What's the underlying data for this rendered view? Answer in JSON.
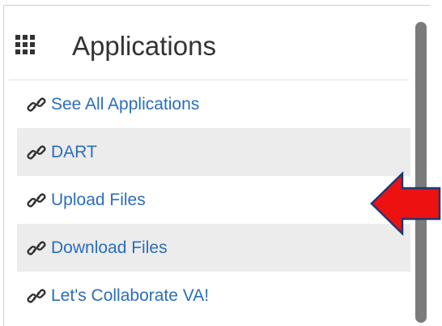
{
  "header": {
    "title": "Applications",
    "icon": "grid-icon"
  },
  "items": [
    {
      "label": "See All Applications",
      "icon": "link-icon"
    },
    {
      "label": "DART",
      "icon": "link-icon"
    },
    {
      "label": "Upload Files",
      "icon": "link-icon"
    },
    {
      "label": "Download Files",
      "icon": "link-icon"
    },
    {
      "label": "Let's Collaborate VA!",
      "icon": "link-icon"
    }
  ],
  "colors": {
    "link": "#2a6ebb",
    "stripe": "#ececec",
    "arrow_fill": "#ee1111",
    "arrow_stroke": "#1a3b73"
  }
}
